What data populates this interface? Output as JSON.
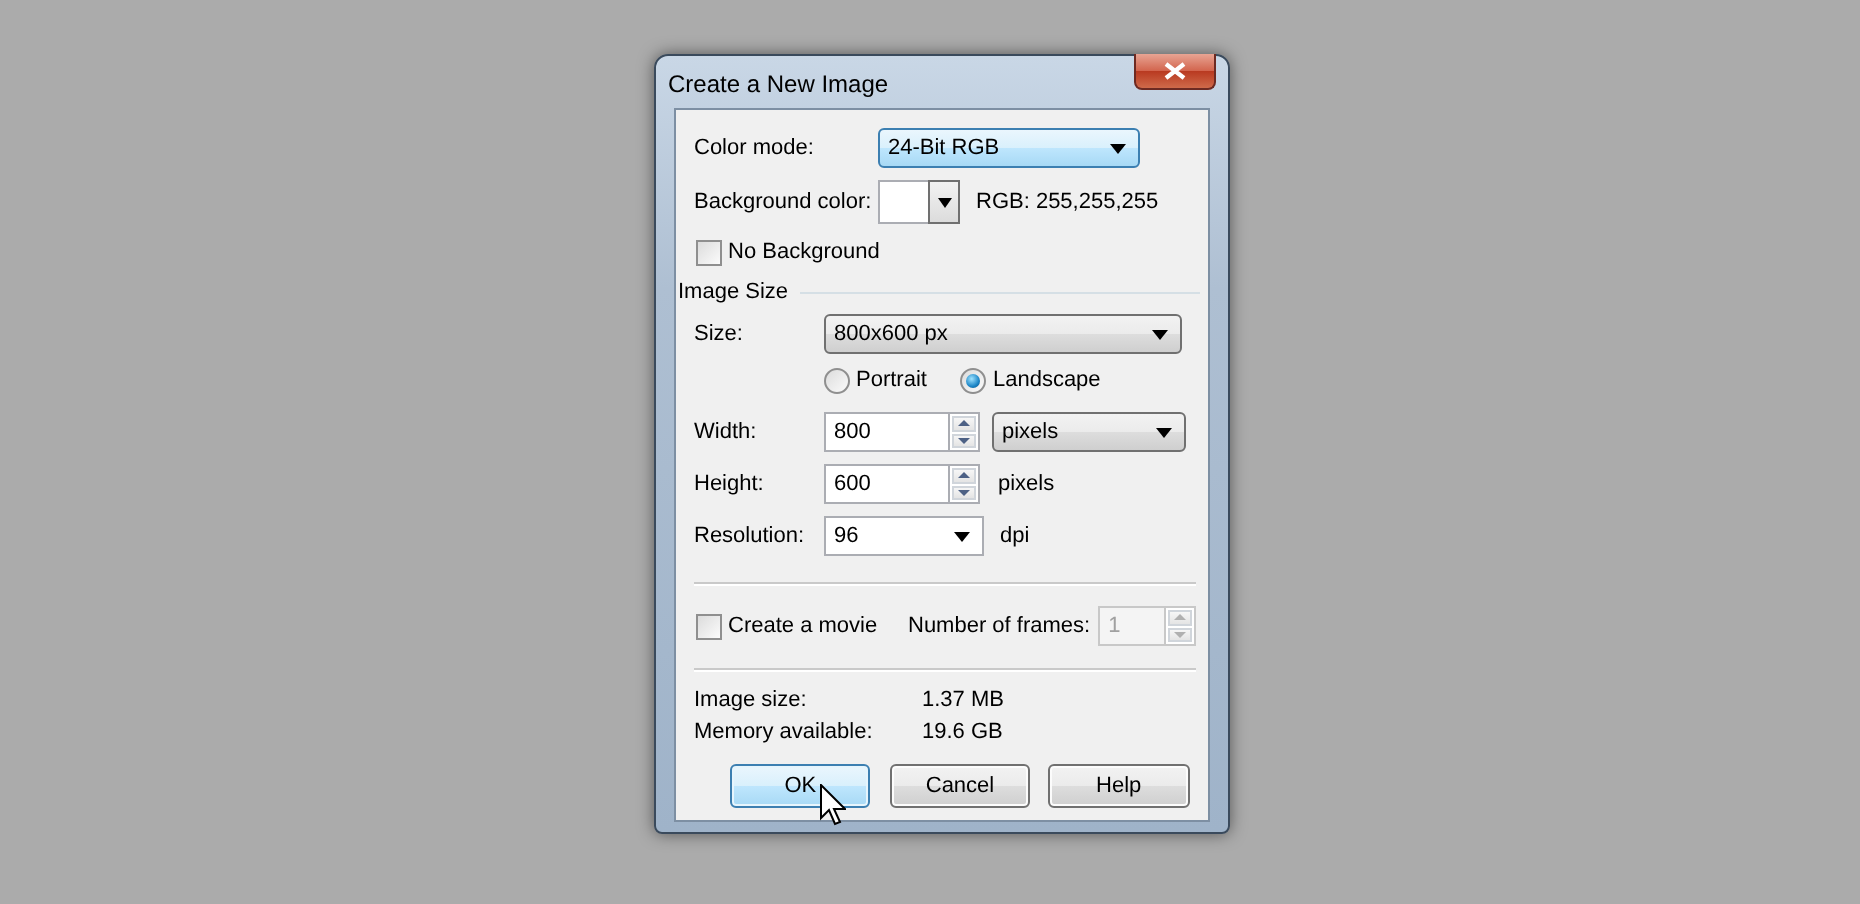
{
  "window": {
    "title": "Create a New Image"
  },
  "color_mode": {
    "label": "Color mode:",
    "value": "24-Bit RGB"
  },
  "background_color": {
    "label": "Background color:",
    "color": "#ffffff",
    "rgb_text": "RGB: 255,255,255"
  },
  "no_background": {
    "label": "No Background",
    "checked": false
  },
  "image_size": {
    "title": "Image Size",
    "size": {
      "label": "Size:",
      "value": "800x600 px"
    },
    "orientation": [
      {
        "label": "Portrait",
        "selected": false
      },
      {
        "label": "Landscape",
        "selected": true
      }
    ],
    "width": {
      "label": "Width:",
      "value": "800",
      "unit": "pixels"
    },
    "height": {
      "label": "Height:",
      "value": "600",
      "unit": "pixels"
    },
    "resolution": {
      "label": "Resolution:",
      "value": "96",
      "unit": "dpi"
    }
  },
  "movie": {
    "label": "Create a movie",
    "checked": false,
    "frames_label": "Number of frames:",
    "frames": "1",
    "frames_disabled": true
  },
  "info": [
    {
      "label": "Image size:",
      "value": "1.37 MB"
    },
    {
      "label": "Memory available:",
      "value": "19.6 GB"
    }
  ],
  "buttons": [
    {
      "label": "OK",
      "hovered": true
    },
    {
      "label": "Cancel",
      "hovered": false
    },
    {
      "label": "Help",
      "hovered": false
    }
  ]
}
